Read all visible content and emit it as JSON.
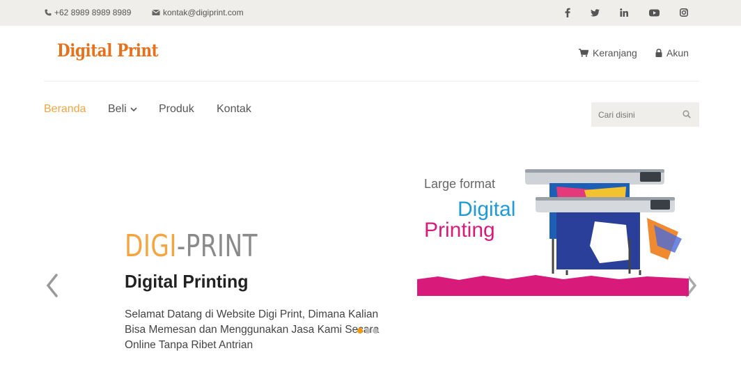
{
  "topbar": {
    "phone": "+62 8989 8989 8989",
    "email": "kontak@digiprint.com",
    "social": [
      "facebook-icon",
      "twitter-icon",
      "linkedin-icon",
      "youtube-icon",
      "instagram-icon"
    ]
  },
  "header": {
    "logo": "Digital Print",
    "cart_label": "Keranjang",
    "account_label": "Akun"
  },
  "nav": {
    "items": [
      {
        "label": "Beranda",
        "active": true
      },
      {
        "label": "Beli",
        "has_dropdown": true
      },
      {
        "label": "Produk"
      },
      {
        "label": "Kontak"
      }
    ],
    "search_placeholder": "Cari disini"
  },
  "slider": {
    "brand_part1": "DIGI",
    "brand_part2": "-PRINT",
    "title": "Digital Printing",
    "description": "Selamat Datang di Website Digi Print, Dimana Kalian Bisa Memesan dan Menggunakan Jasa Kami Secara Online Tanpa Ribet Antrian",
    "banner": {
      "line1": "Large format",
      "line2": "Digital",
      "line3": "Printing"
    },
    "dots": 3,
    "active_dot": 0
  },
  "colors": {
    "accent": "#f5a540",
    "topbar_bg": "#efeeea",
    "banner_magenta": "#d81b7a",
    "banner_blue": "#1e9ad6"
  }
}
